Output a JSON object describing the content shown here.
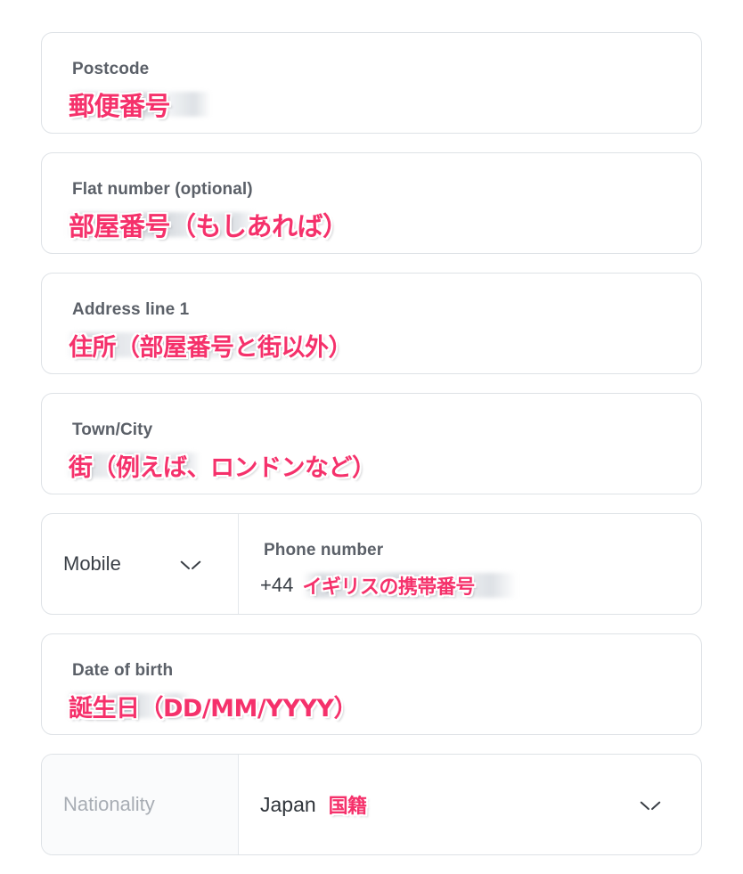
{
  "form": {
    "fields": [
      {
        "id": "postcode",
        "label": "Postcode",
        "annotation": "郵便番号",
        "redacted": true
      },
      {
        "id": "flat-number",
        "label": "Flat number (optional)",
        "annotation": "部屋番号（もしあれば）",
        "redacted": true
      },
      {
        "id": "address-line-1",
        "label": "Address line 1",
        "annotation": "住所（部屋番号と街以外）",
        "redacted": true
      },
      {
        "id": "town-city",
        "label": "Town/City",
        "annotation": "街（例えば、ロンドンなど）",
        "redacted": true
      },
      {
        "id": "date-of-birth",
        "label": "Date of birth",
        "annotation": "誕生日（DD/MM/YYYY）",
        "redacted": true
      }
    ],
    "phone_row": {
      "type_label": "Mobile",
      "number_label": "Phone number",
      "dial_code": "+44",
      "annotation": "イギリスの携帯番号"
    },
    "nationality_row": {
      "label": "Nationality",
      "value": "Japan",
      "annotation": "国籍"
    }
  },
  "colors": {
    "annotation_pink": "#f5316b",
    "label_grey": "#5b6068",
    "value_grey": "#3a3f46",
    "border_grey": "#dee2e6",
    "placeholder_grey": "#a8adb4"
  }
}
